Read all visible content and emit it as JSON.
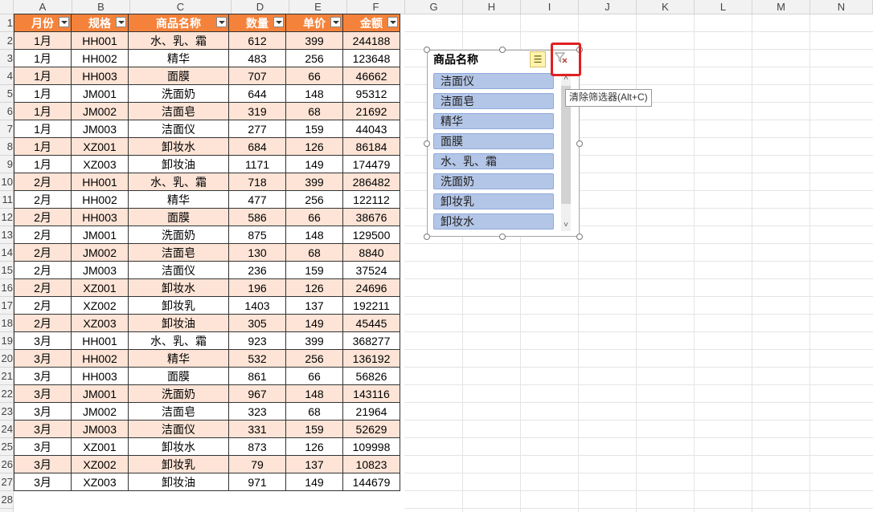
{
  "columns": [
    "A",
    "B",
    "C",
    "D",
    "E",
    "F",
    "G",
    "H",
    "I",
    "J",
    "K",
    "L",
    "M",
    "N"
  ],
  "rows": [
    "1",
    "2",
    "3",
    "4",
    "5",
    "6",
    "7",
    "8",
    "9",
    "10",
    "11",
    "12",
    "13",
    "14",
    "15",
    "16",
    "17",
    "18",
    "19",
    "20",
    "21",
    "22",
    "23",
    "24",
    "25",
    "26",
    "27",
    "28"
  ],
  "table": {
    "headers": [
      "月份",
      "规格",
      "商品名称",
      "数量",
      "单价",
      "金额"
    ],
    "rows": [
      [
        "1月",
        "HH001",
        "水、乳、霜",
        "612",
        "399",
        "244188"
      ],
      [
        "1月",
        "HH002",
        "精华",
        "483",
        "256",
        "123648"
      ],
      [
        "1月",
        "HH003",
        "面膜",
        "707",
        "66",
        "46662"
      ],
      [
        "1月",
        "JM001",
        "洗面奶",
        "644",
        "148",
        "95312"
      ],
      [
        "1月",
        "JM002",
        "洁面皂",
        "319",
        "68",
        "21692"
      ],
      [
        "1月",
        "JM003",
        "洁面仪",
        "277",
        "159",
        "44043"
      ],
      [
        "1月",
        "XZ001",
        "卸妆水",
        "684",
        "126",
        "86184"
      ],
      [
        "1月",
        "XZ003",
        "卸妆油",
        "1171",
        "149",
        "174479"
      ],
      [
        "2月",
        "HH001",
        "水、乳、霜",
        "718",
        "399",
        "286482"
      ],
      [
        "2月",
        "HH002",
        "精华",
        "477",
        "256",
        "122112"
      ],
      [
        "2月",
        "HH003",
        "面膜",
        "586",
        "66",
        "38676"
      ],
      [
        "2月",
        "JM001",
        "洗面奶",
        "875",
        "148",
        "129500"
      ],
      [
        "2月",
        "JM002",
        "洁面皂",
        "130",
        "68",
        "8840"
      ],
      [
        "2月",
        "JM003",
        "洁面仪",
        "236",
        "159",
        "37524"
      ],
      [
        "2月",
        "XZ001",
        "卸妆水",
        "196",
        "126",
        "24696"
      ],
      [
        "2月",
        "XZ002",
        "卸妆乳",
        "1403",
        "137",
        "192211"
      ],
      [
        "2月",
        "XZ003",
        "卸妆油",
        "305",
        "149",
        "45445"
      ],
      [
        "3月",
        "HH001",
        "水、乳、霜",
        "923",
        "399",
        "368277"
      ],
      [
        "3月",
        "HH002",
        "精华",
        "532",
        "256",
        "136192"
      ],
      [
        "3月",
        "HH003",
        "面膜",
        "861",
        "66",
        "56826"
      ],
      [
        "3月",
        "JM001",
        "洗面奶",
        "967",
        "148",
        "143116"
      ],
      [
        "3月",
        "JM002",
        "洁面皂",
        "323",
        "68",
        "21964"
      ],
      [
        "3月",
        "JM003",
        "洁面仪",
        "331",
        "159",
        "52629"
      ],
      [
        "3月",
        "XZ001",
        "卸妆水",
        "873",
        "126",
        "109998"
      ],
      [
        "3月",
        "XZ002",
        "卸妆乳",
        "79",
        "137",
        "10823"
      ],
      [
        "3月",
        "XZ003",
        "卸妆油",
        "971",
        "149",
        "144679"
      ]
    ]
  },
  "slicer": {
    "title": "商品名称",
    "multi_select_icon": "multi-select-icon",
    "clear_filter_icon": "clear-filter-icon",
    "items": [
      "洁面仪",
      "洁面皂",
      "精华",
      "面膜",
      "水、乳、霜",
      "洗面奶",
      "卸妆乳",
      "卸妆水"
    ],
    "tooltip": "清除筛选器(Alt+C)"
  },
  "colors": {
    "header_fill": "#f5823a",
    "band_fill": "#fde4d6",
    "slicer_item": "#b4c6e7",
    "highlight_box": "#e02020"
  }
}
